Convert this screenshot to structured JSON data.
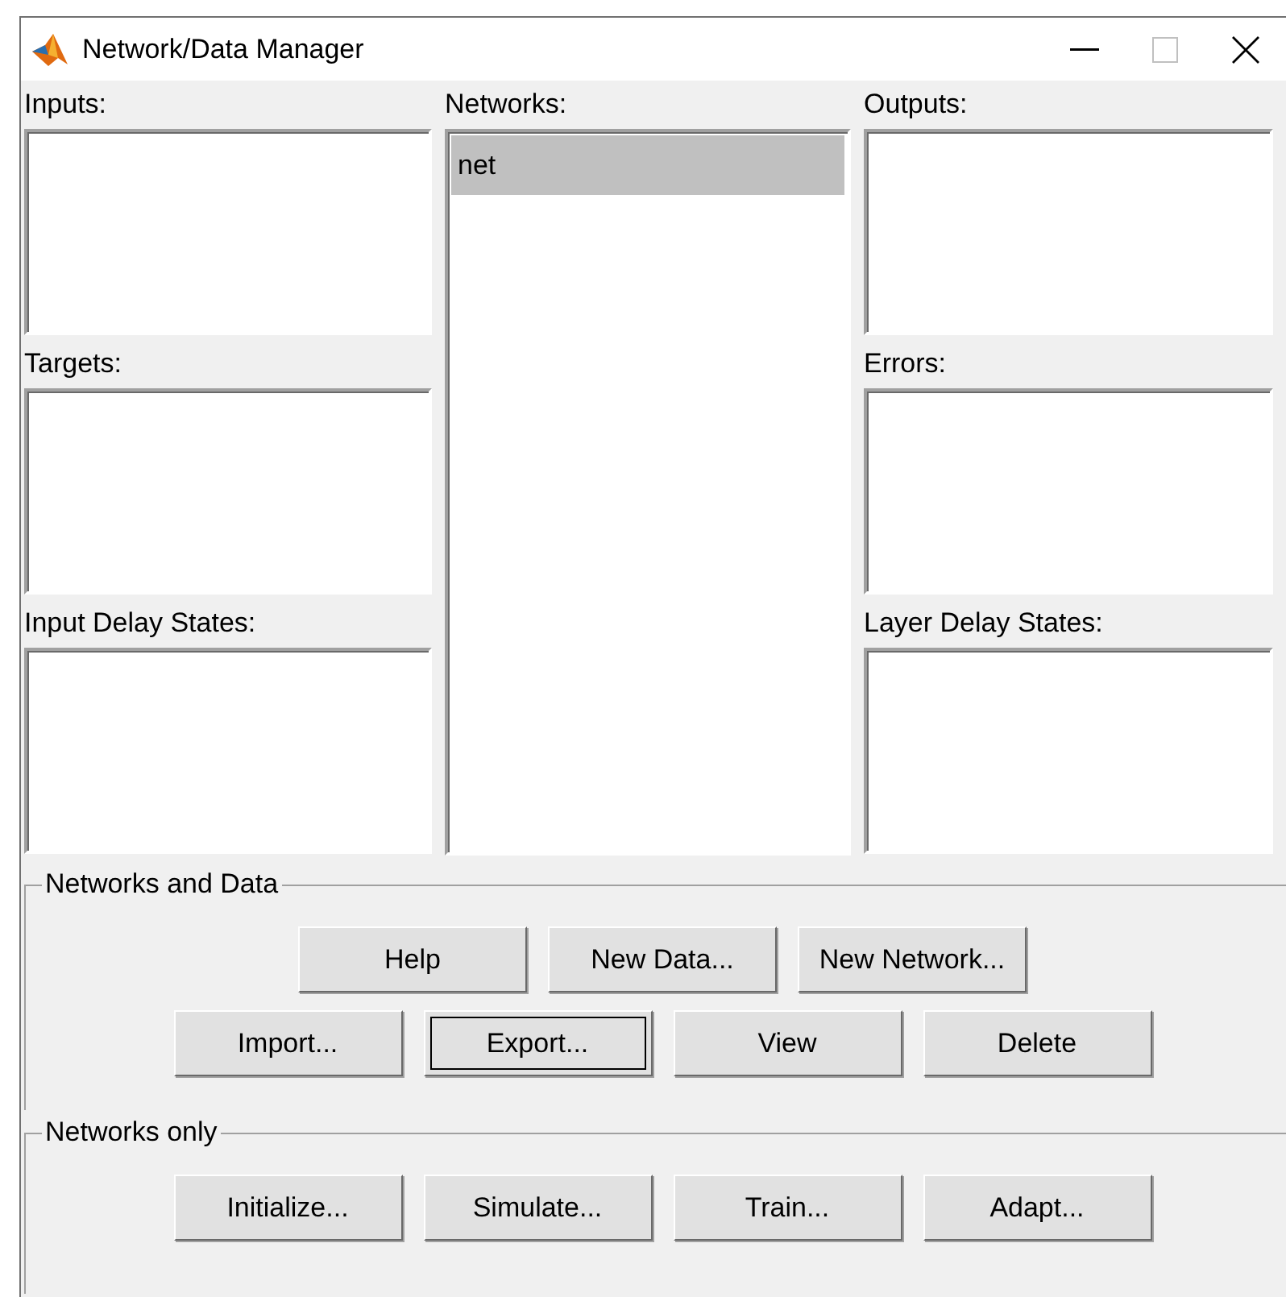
{
  "window": {
    "title": "Network/Data Manager"
  },
  "left_lists": [
    {
      "label": "Inputs:"
    },
    {
      "label": "Targets:"
    },
    {
      "label": "Input Delay States:"
    }
  ],
  "networks": {
    "label": "Networks:",
    "items": [
      {
        "label": "net",
        "selected": true
      }
    ]
  },
  "right_lists": [
    {
      "label": "Outputs:"
    },
    {
      "label": "Errors:"
    },
    {
      "label": "Layer Delay States:"
    }
  ],
  "groups": [
    {
      "title": "Networks and Data",
      "rows": [
        [
          {
            "label": "Help",
            "focused": false
          },
          {
            "label": "New Data...",
            "focused": false
          },
          {
            "label": "New Network...",
            "focused": false
          }
        ],
        [
          {
            "label": "Import...",
            "focused": false
          },
          {
            "label": "Export...",
            "focused": true
          },
          {
            "label": "View",
            "focused": false
          },
          {
            "label": "Delete",
            "focused": false
          }
        ]
      ]
    },
    {
      "title": "Networks only",
      "rows": [
        [
          {
            "label": "Initialize...",
            "focused": false
          },
          {
            "label": "Simulate...",
            "focused": false
          },
          {
            "label": "Train...",
            "focused": false
          },
          {
            "label": "Adapt...",
            "focused": false
          }
        ]
      ]
    }
  ]
}
